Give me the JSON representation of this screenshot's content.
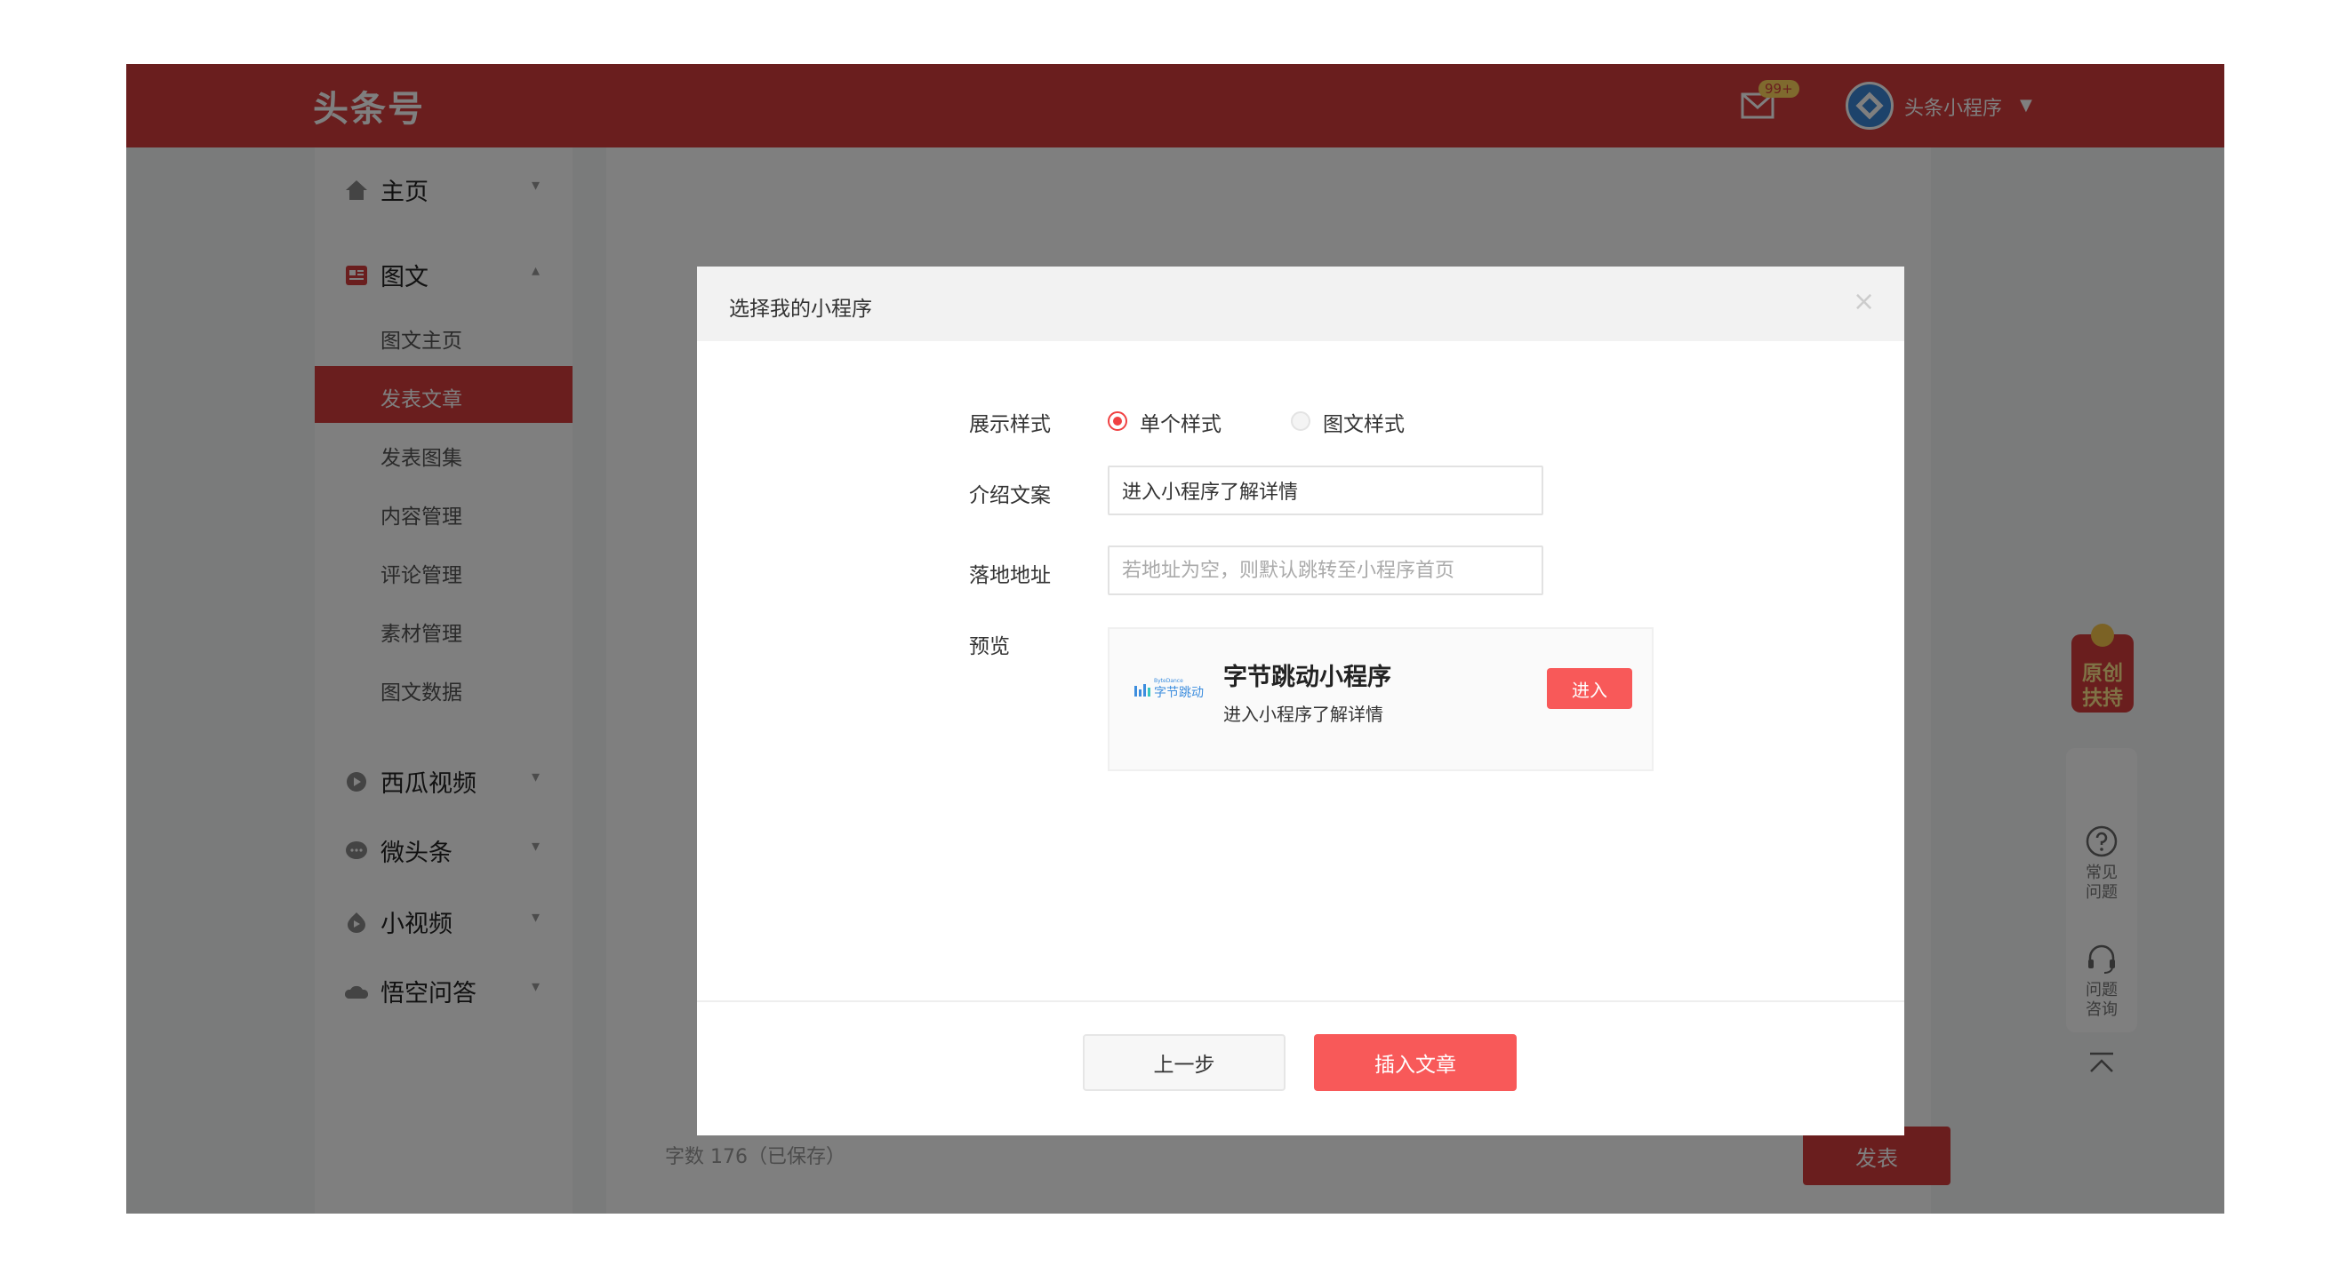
{
  "header": {
    "logo": "头条号",
    "mail_badge": "99+",
    "user_name": "头条小程序",
    "user_caret": "▼"
  },
  "sidebar": {
    "home": "主页",
    "graphic": "图文",
    "graphic_items": [
      "图文主页",
      "发表文章",
      "发表图集",
      "内容管理",
      "评论管理",
      "素材管理",
      "图文数据"
    ],
    "active_index": 1,
    "xigua": "西瓜视频",
    "weitoutiao": "微头条",
    "small_video": "小视频",
    "wukong": "悟空问答"
  },
  "editor": {
    "word_count": "字数 176（已保存）",
    "publish_label": "发表"
  },
  "right_tools": {
    "promo_line1": "原创",
    "promo_line2": "扶持",
    "faq_line1": "常见",
    "faq_line2": "问题",
    "consult_line1": "问题",
    "consult_line2": "咨询"
  },
  "modal": {
    "title": "选择我的小程序",
    "close": "×",
    "display_style_label": "展示样式",
    "style_single": "单个样式",
    "style_graphic": "图文样式",
    "selected_style": "单个样式",
    "intro_label": "介绍文案",
    "intro_value": "进入小程序了解详情",
    "landing_label": "落地地址",
    "landing_placeholder": "若地址为空，则默认跳转至小程序首页",
    "preview_label": "预览",
    "preview": {
      "logo_small_text": "ByteDance",
      "logo_text": "字节跳动",
      "name": "字节跳动小程序",
      "desc": "进入小程序了解详情",
      "enter_label": "进入"
    },
    "prev_button": "上一步",
    "insert_button": "插入文章"
  },
  "colors": {
    "brand_red": "#d43d3d",
    "button_red": "#f85959",
    "radio_red": "#f04142"
  }
}
